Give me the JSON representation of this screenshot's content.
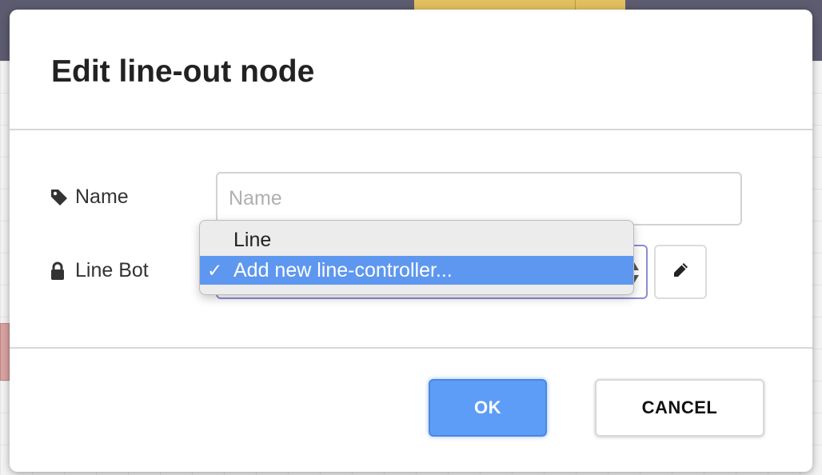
{
  "dialog": {
    "title": "Edit line-out node"
  },
  "fields": {
    "name": {
      "label": "Name",
      "icon": "tag-icon",
      "value": "",
      "placeholder": "Name"
    },
    "line_bot": {
      "label": "Line Bot",
      "icon": "lock-icon",
      "selected": "Add new line-controller..."
    }
  },
  "dropdown": {
    "options": [
      {
        "label": "Line",
        "selected": false
      },
      {
        "label": "Add new line-controller...",
        "selected": true
      }
    ],
    "check": "✓"
  },
  "buttons": {
    "edit_icon": "pencil-icon",
    "ok_label": "OK",
    "cancel_label": "CANCEL"
  },
  "colors": {
    "primary": "#5d9df7",
    "selection": "#5d97ef",
    "focus_border": "#8d8bd3"
  }
}
